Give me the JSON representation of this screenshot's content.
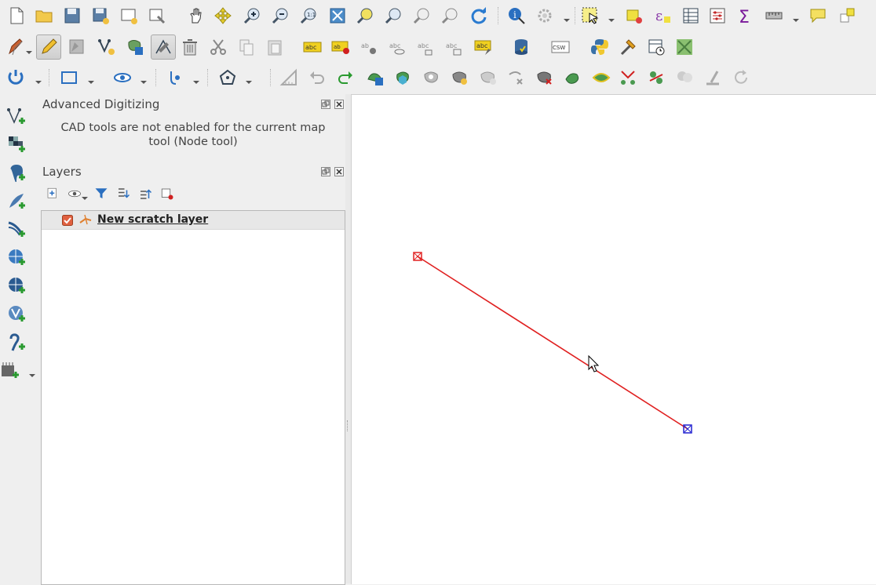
{
  "advanced_digitizing": {
    "title": "Advanced Digitizing",
    "message": "CAD tools are not enabled for the current map tool (Node tool)"
  },
  "layers_panel": {
    "title": "Layers",
    "layers": [
      {
        "name": "New scratch layer",
        "visible": true,
        "geometry": "line"
      }
    ]
  },
  "toolbar_icons": {
    "row1": [
      "new-project-icon",
      "open-project-icon",
      "save-project-icon",
      "save-as-icon",
      "new-print-layout-icon",
      "layout-manager-icon",
      "pan-icon",
      "pan-to-selection-icon",
      "zoom-in-icon",
      "zoom-out-icon",
      "zoom-native-icon",
      "zoom-full-icon",
      "zoom-to-selection-icon",
      "zoom-to-layer-icon",
      "zoom-last-icon",
      "zoom-next-icon",
      "refresh-icon",
      "identify-icon",
      "action-icon",
      "select-features-icon",
      "deselect-icon",
      "expression-select-icon",
      "attribute-table-icon",
      "statistics-icon",
      "field-calculator-icon",
      "measure-icon",
      "map-tips-icon",
      "text-annotation-icon"
    ],
    "row2": [
      "current-edits-icon",
      "toggle-editing-icon",
      "save-edits-icon",
      "add-feature-icon",
      "add-ring-icon",
      "node-tool-icon",
      "delete-selected-icon",
      "cut-features-icon",
      "copy-features-icon",
      "paste-features-icon",
      "label-toolbar-icon",
      "pin-label-icon",
      "show-label-icon",
      "move-label-icon",
      "rotate-label-icon",
      "change-label-icon",
      "db-manager-icon",
      "csw-icon",
      "python-console-icon",
      "processing-icon",
      "temporal-icon",
      "georeferencer-icon"
    ],
    "row3": [
      "snapping-icon",
      "shape-digitizing-icon",
      "visibility-icon",
      "trace-icon",
      "shape-regular-icon",
      "cad-icon",
      "undo-icon",
      "redo-icon",
      "simplify-icon",
      "add-part-icon",
      "fill-ring-icon",
      "delete-part-icon",
      "delete-ring-icon",
      "reshape-icon",
      "offset-curve-icon",
      "split-features-icon",
      "split-parts-icon",
      "merge-features-icon",
      "merge-attributes-icon",
      "rotate-point-icon",
      "reverse-line-icon"
    ],
    "left": [
      "add-vector-icon",
      "add-raster-icon",
      "add-postgis-icon",
      "add-spatialite-icon",
      "add-mssql-icon",
      "add-wms-icon",
      "add-wfs-icon",
      "add-wcs-icon",
      "add-delimited-icon",
      "add-virtual-icon"
    ]
  },
  "colors": {
    "line": "#e02020",
    "start_vertex": "#e02020",
    "end_vertex": "#2020d0",
    "canvas": "#ffffff"
  }
}
